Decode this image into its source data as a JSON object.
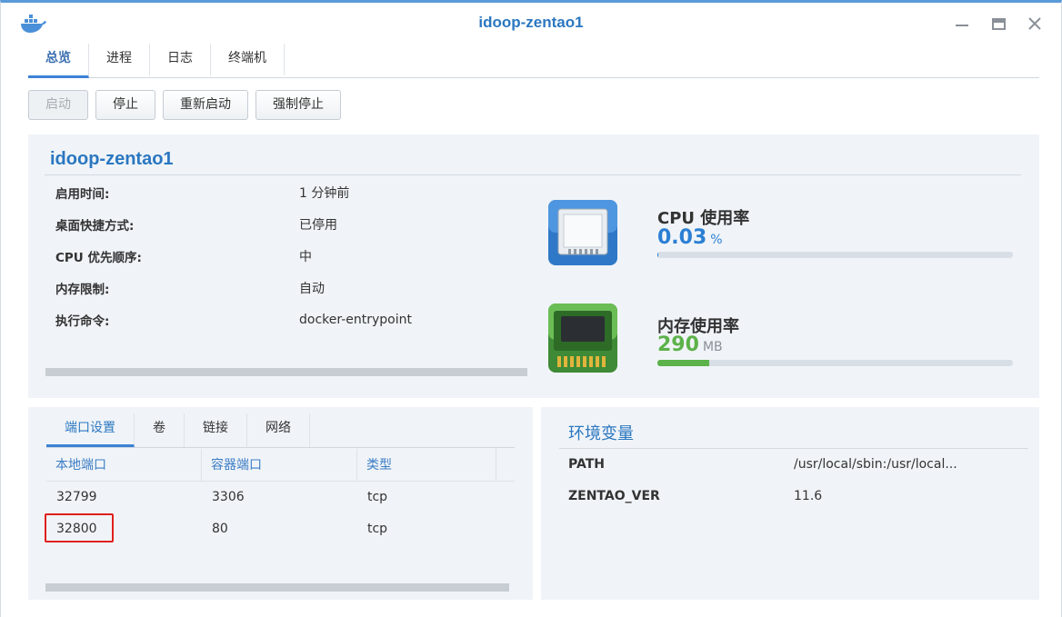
{
  "window": {
    "title": "idoop-zentao1"
  },
  "tabs": [
    {
      "label": "总览",
      "active": true
    },
    {
      "label": "进程",
      "active": false
    },
    {
      "label": "日志",
      "active": false
    },
    {
      "label": "终端机",
      "active": false
    }
  ],
  "actions": {
    "start": "启动",
    "stop": "停止",
    "restart": "重新启动",
    "force_stop": "强制停止"
  },
  "overview": {
    "name": "idoop-zentao1",
    "fields": [
      {
        "key": "启用时间:",
        "value": "1 分钟前"
      },
      {
        "key": "桌面快捷方式:",
        "value": "已停用"
      },
      {
        "key": "CPU 优先顺序:",
        "value": "中"
      },
      {
        "key": "内存限制:",
        "value": "自动"
      },
      {
        "key": "执行命令:",
        "value": "docker-entrypoint"
      }
    ],
    "cpu": {
      "label": "CPU 使用率",
      "value": "0.03",
      "unit": "%",
      "fraction": 0.0003,
      "color": "#2b7fd3"
    },
    "memory": {
      "label": "内存使用率",
      "value": "290",
      "unit": "MB",
      "fraction": 0.145,
      "color": "#5cb24a"
    }
  },
  "ports": {
    "subtabs": [
      "端口设置",
      "卷",
      "链接",
      "网络"
    ],
    "columns": [
      "本地端口",
      "容器端口",
      "类型"
    ],
    "rows": [
      {
        "local": "32799",
        "container": "3306",
        "type": "tcp"
      },
      {
        "local": "32800",
        "container": "80",
        "type": "tcp"
      }
    ]
  },
  "env": {
    "title": "环境变量",
    "rows": [
      {
        "key": "PATH",
        "value": "/usr/local/sbin:/usr/local..."
      },
      {
        "key": "ZENTAO_VER",
        "value": "11.6"
      }
    ]
  },
  "colors": {
    "accent": "#2b77c0",
    "highlight": "#e0201b"
  }
}
